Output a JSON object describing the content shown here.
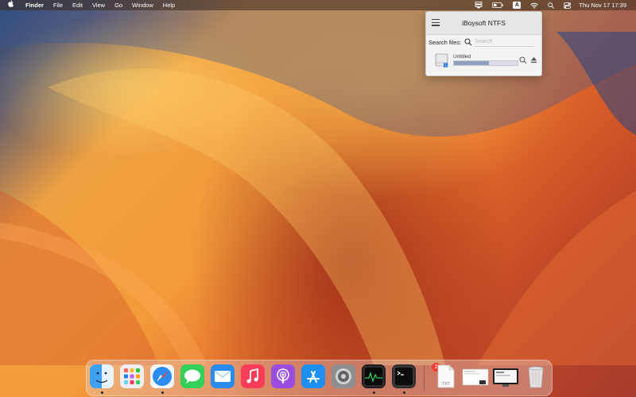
{
  "menubar": {
    "app_name": "Finder",
    "menus": [
      "File",
      "Edit",
      "View",
      "Go",
      "Window",
      "Help"
    ],
    "status_input_letter": "A",
    "clock": "Thu Nov 17  17:39"
  },
  "iboysoft": {
    "title": "iBoysoft NTFS",
    "search_label": "Search files:",
    "search_placeholder": "Search",
    "drives": [
      {
        "name": "Untitled",
        "usage_fraction": 0.55
      }
    ]
  },
  "dock": {
    "apps": [
      "Finder",
      "Launchpad",
      "Safari",
      "Messages",
      "Mail",
      "Music",
      "Podcasts",
      "App Store",
      "System Settings",
      "Activity Monitor",
      "Terminal"
    ],
    "settings_badge": "2",
    "txt_label": "TXT",
    "running": [
      "Finder",
      "Safari",
      "Activity Monitor",
      "Terminal"
    ]
  }
}
